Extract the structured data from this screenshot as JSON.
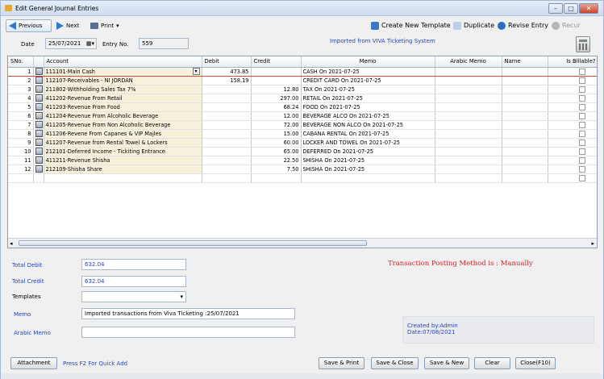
{
  "window": {
    "title": "Edit General Journal Entries"
  },
  "toolbar": {
    "previous": "Previous",
    "next": "Next",
    "print": "Print",
    "print_arrow": "▾",
    "create_template": "Create New Template",
    "duplicate": "Duplicate",
    "revise_entry": "Revise Entry",
    "recur": "Recur"
  },
  "header": {
    "date_label": "Date",
    "date_value": "25/07/2021",
    "entry_no_label": "Entry No.",
    "entry_no_value": "559",
    "imported_note": "Imported from VIVA Ticketing System"
  },
  "columns": {
    "sno": "SNo.",
    "account": "Account",
    "debit": "Debit",
    "credit": "Credit",
    "memo": "Memo",
    "arabic_memo": "Arabic Memo",
    "name": "Name",
    "billable": "Is Billable?"
  },
  "rows": [
    {
      "sno": "1",
      "account": "111101·Main Cash",
      "debit": "473.85",
      "credit": "",
      "memo": "CASH On 2021-07-25"
    },
    {
      "sno": "2",
      "account": "112107·Receivables - NI JORDAN",
      "debit": "158.19",
      "credit": "",
      "memo": "CREDIT CARD On 2021-07-25"
    },
    {
      "sno": "3",
      "account": "211802·Withholding Sales Tax 7%",
      "debit": "",
      "credit": "12.80",
      "memo": "TAX On 2021-07-25"
    },
    {
      "sno": "4",
      "account": "411202·Revenue From Retail",
      "debit": "",
      "credit": "297.00",
      "memo": "RETAIL On 2021-07-25"
    },
    {
      "sno": "5",
      "account": "411203·Revenue From Food",
      "debit": "",
      "credit": "68.24",
      "memo": "FOOD On 2021-07-25"
    },
    {
      "sno": "6",
      "account": "411204·Revenue From Alcoholic Beverage",
      "debit": "",
      "credit": "12.00",
      "memo": "BEVERAGE ALCO On 2021-07-25"
    },
    {
      "sno": "7",
      "account": "411205·Revenue From Non Alcoholic Beverage",
      "debit": "",
      "credit": "72.00",
      "memo": "BEVERAGE NON ALCO On 2021-07-25"
    },
    {
      "sno": "8",
      "account": "411206·Revene From Capanes & VIP Majles",
      "debit": "",
      "credit": "15.00",
      "memo": "CABANA RENTAL On 2021-07-25"
    },
    {
      "sno": "9",
      "account": "411207·Revenue from Rental Towel & Lockers",
      "debit": "",
      "credit": "60.00",
      "memo": "LOCKER AND TOWEL On 2021-07-25"
    },
    {
      "sno": "10",
      "account": "212101·Deferred Income - Tickiting Entrance",
      "debit": "",
      "credit": "65.00",
      "memo": "DEFERRED On 2021-07-25"
    },
    {
      "sno": "11",
      "account": "411211·Revenue Shisha",
      "debit": "",
      "credit": "22.50",
      "memo": "SHISHA On 2021-07-25"
    },
    {
      "sno": "12",
      "account": "212109·Shisha Share",
      "debit": "",
      "credit": "7.50",
      "memo": "SHISHA On 2021-07-25"
    }
  ],
  "totals": {
    "debit_label": "Total Debit",
    "debit_value": "632.04",
    "credit_label": "Total Credit",
    "credit_value": "632.04"
  },
  "posting_method": "Transaction Posting Method is : Manually",
  "templates": {
    "label": "Templates",
    "value": ""
  },
  "memo": {
    "label": "Memo",
    "value": "Imported transactions from Viva Ticketing :25/07/2021"
  },
  "arabic_memo": {
    "label": "Arabic Memo",
    "value": ""
  },
  "created": {
    "by": "Created by:Admin",
    "date": "Date:07/08/2021"
  },
  "footer": {
    "attachment": "Attachment",
    "quick_add_hint": "Press F2 For Quick Add",
    "save_print": "Save & Print",
    "save_close": "Save & Close",
    "save_new": "Save & New",
    "clear": "Clear",
    "close": "Close(F10)"
  },
  "colors": {
    "accent_blue": "#2b43b8",
    "posting_red": "#d0262b",
    "account_bg": "#f7f1dc"
  }
}
